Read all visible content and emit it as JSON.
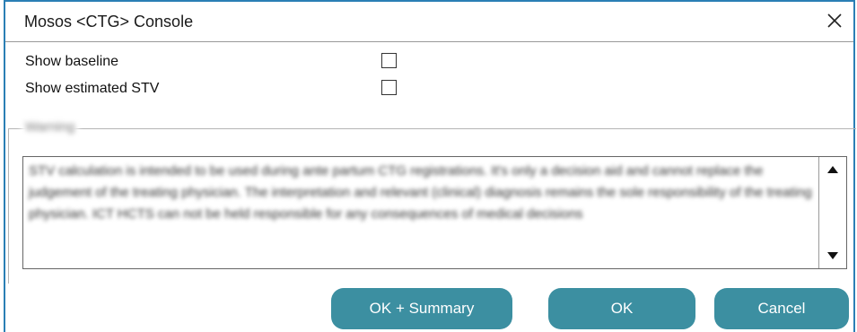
{
  "window": {
    "title": "Mosos <CTG> Console"
  },
  "options": [
    {
      "label": "Show baseline",
      "checked": false
    },
    {
      "label": "Show estimated STV",
      "checked": false
    }
  ],
  "group": {
    "title": "Warning"
  },
  "disclaimer": {
    "text": "STV calculation is intended to be used during ante partum CTG registrations. It's only a decision aid and cannot replace the judgement of the treating physician. The interpretation and relevant (clinical) diagnosis remains the sole responsibility of the treating physician. ICT HCTS can not be held responsible for any consequences of medical decisions"
  },
  "buttons": {
    "ok_summary": "OK + Summary",
    "ok": "OK",
    "cancel": "Cancel"
  },
  "colors": {
    "button_bg": "#3c8fa1",
    "frame": "#2a7fb5"
  },
  "icons": {
    "close": "close-icon",
    "scroll_up": "arrow-up-icon",
    "scroll_down": "arrow-down-icon"
  }
}
